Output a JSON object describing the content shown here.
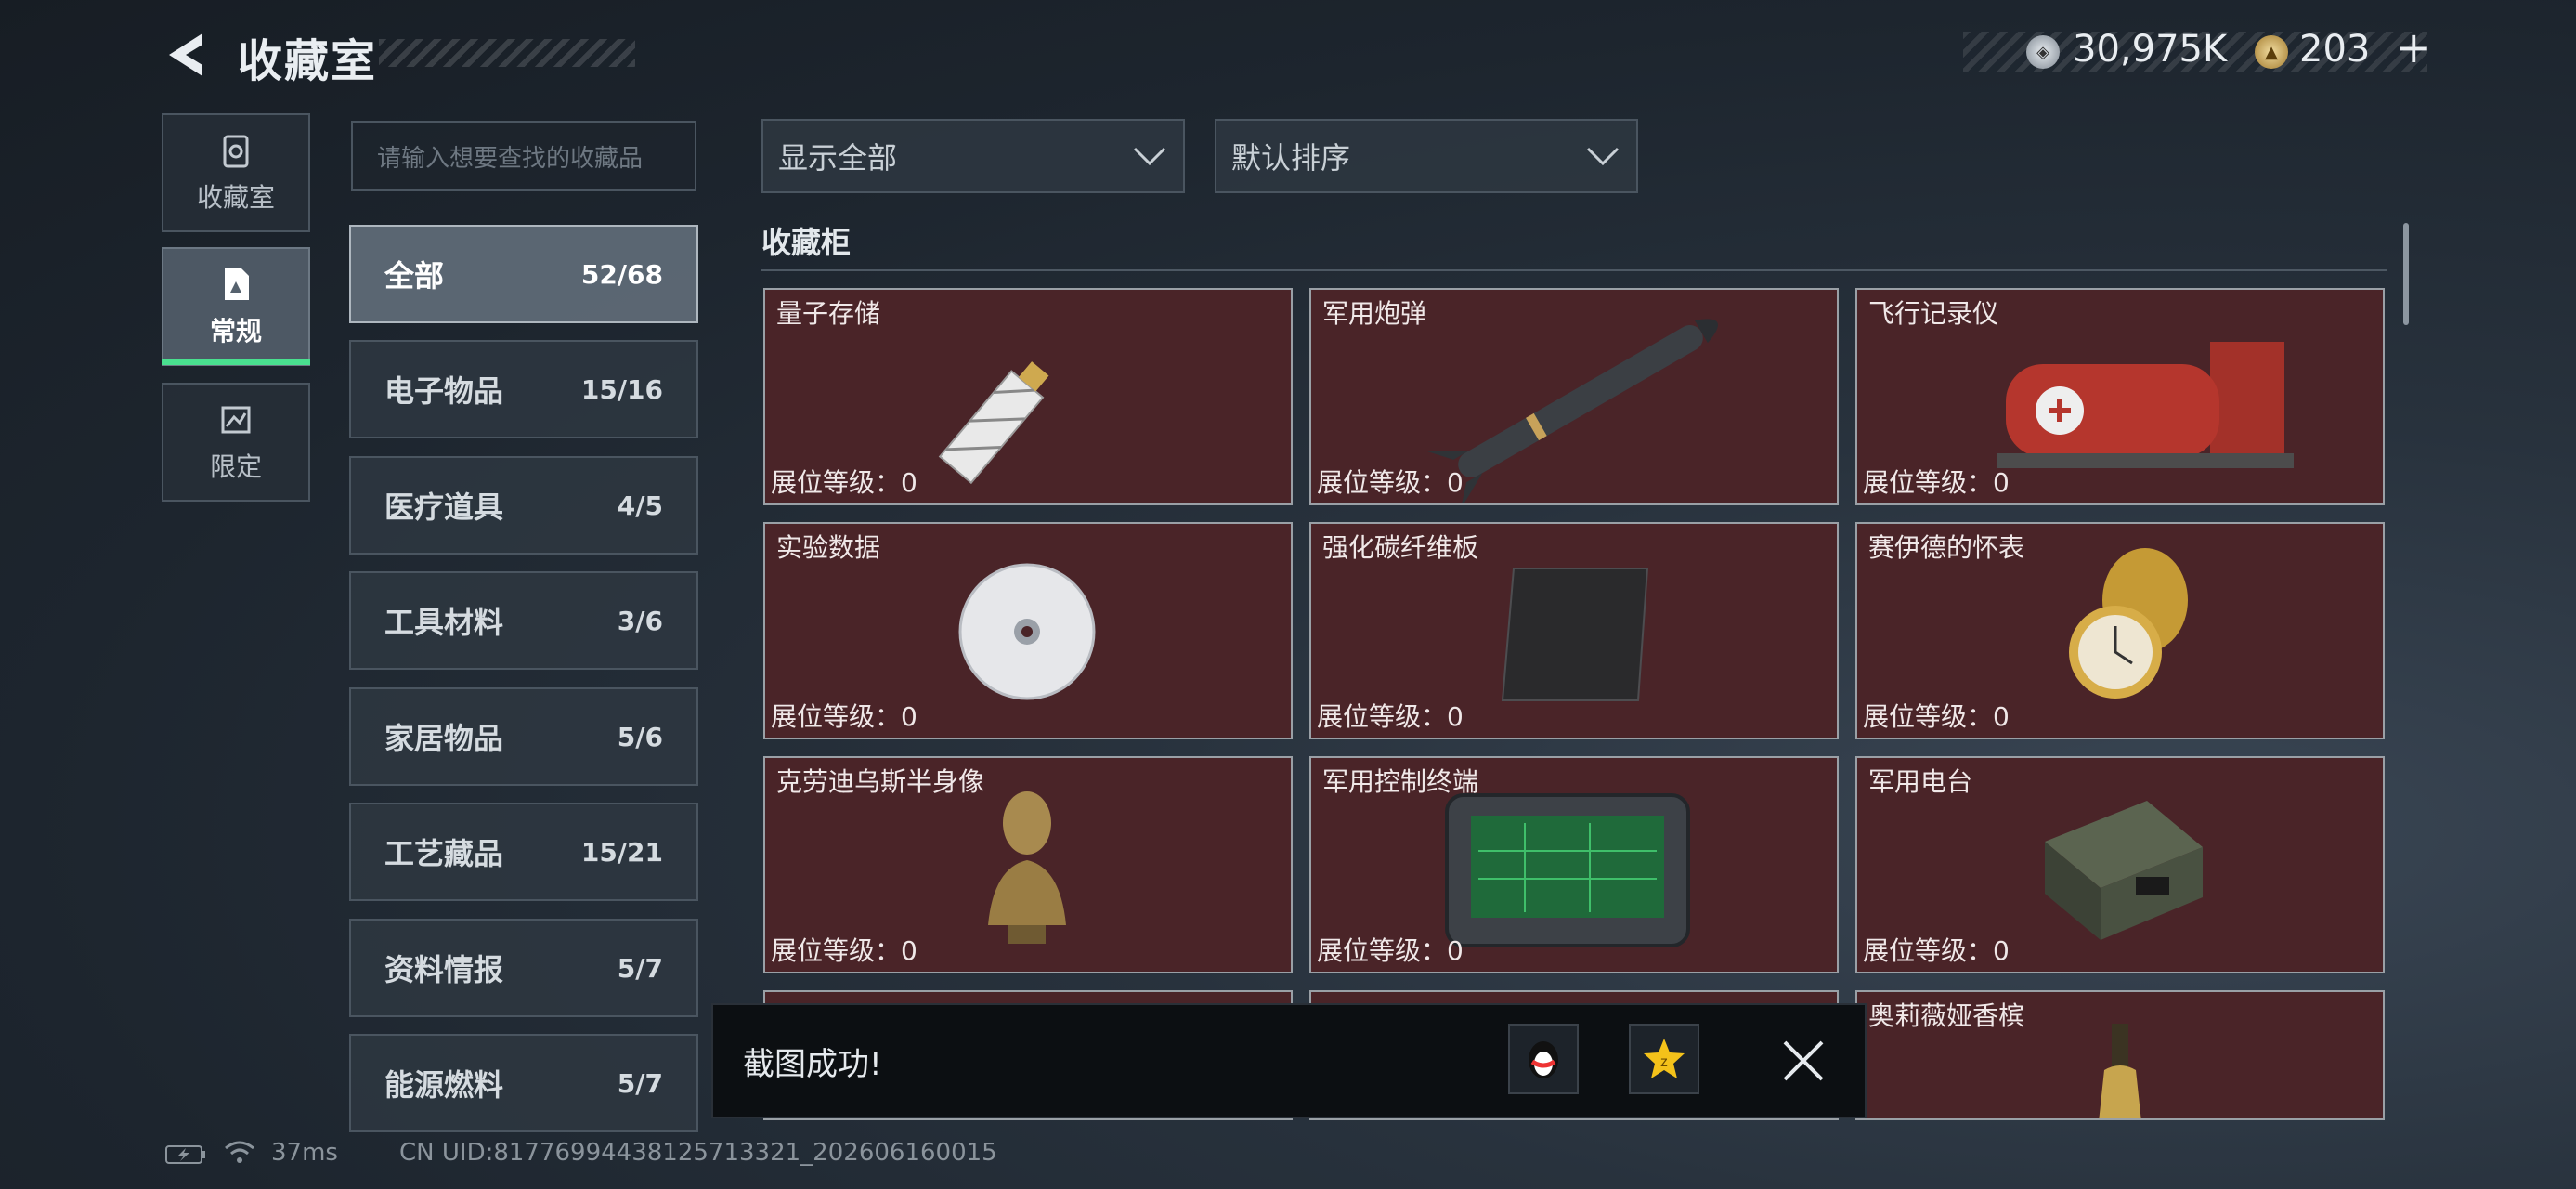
{
  "header": {
    "title": "收藏室",
    "currency_silver": "30,975K",
    "currency_gold": "203",
    "currency_plus": "+"
  },
  "rail": [
    {
      "label": "收藏室",
      "icon": "vault-icon"
    },
    {
      "label": "常规",
      "icon": "document-icon"
    },
    {
      "label": "限定",
      "icon": "limited-icon"
    }
  ],
  "search": {
    "placeholder": "请输入想要查找的收藏品"
  },
  "categories": [
    {
      "name": "全部",
      "count": "52/68"
    },
    {
      "name": "电子物品",
      "count": "15/16"
    },
    {
      "name": "医疗道具",
      "count": "4/5"
    },
    {
      "name": "工具材料",
      "count": "3/6"
    },
    {
      "name": "家居物品",
      "count": "5/6"
    },
    {
      "name": "工艺藏品",
      "count": "15/21"
    },
    {
      "name": "资料情报",
      "count": "5/7"
    },
    {
      "name": "能源燃料",
      "count": "5/7"
    }
  ],
  "filters": {
    "show": "显示全部",
    "sort": "默认排序"
  },
  "section_title": "收藏柜",
  "level_label": "展位等级：0",
  "items": [
    {
      "name": "量子存储",
      "icon": "usb-drive-icon"
    },
    {
      "name": "军用炮弹",
      "icon": "missile-icon"
    },
    {
      "name": "飞行记录仪",
      "icon": "flight-recorder-icon"
    },
    {
      "name": "实验数据",
      "icon": "disc-icon"
    },
    {
      "name": "强化碳纤维板",
      "icon": "carbon-plate-icon"
    },
    {
      "name": "赛伊德的怀表",
      "icon": "pocket-watch-icon"
    },
    {
      "name": "克劳迪乌斯半身像",
      "icon": "bust-icon"
    },
    {
      "name": "军用控制终端",
      "icon": "terminal-icon"
    },
    {
      "name": "军用电台",
      "icon": "radio-icon"
    },
    {
      "name": "",
      "icon": "unknown-item-icon"
    },
    {
      "name": "",
      "icon": "unknown-item-icon"
    },
    {
      "name": "奥莉薇娅香槟",
      "icon": "champagne-icon"
    }
  ],
  "toast": {
    "text": "截图成功!"
  },
  "status": {
    "ping": "37ms",
    "uid": "CN UID:8177699443812571332​1_202606160015"
  }
}
